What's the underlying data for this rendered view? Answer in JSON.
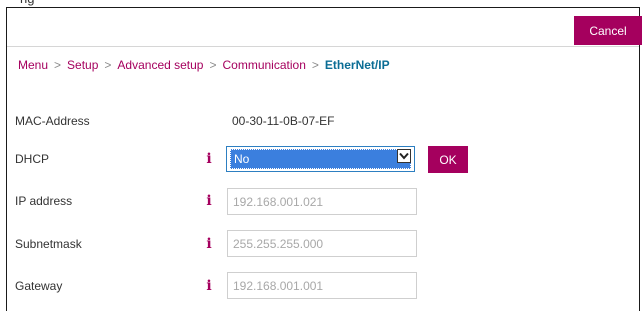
{
  "top_strip": {
    "text": "ng"
  },
  "header": {
    "cancel_label": "Cancel"
  },
  "breadcrumb": {
    "items": [
      "Menu",
      "Setup",
      "Advanced setup",
      "Communication"
    ],
    "separator": ">",
    "current": "EtherNet/IP"
  },
  "fields": {
    "mac": {
      "label": "MAC-Address",
      "value": "00-30-11-0B-07-EF"
    },
    "dhcp": {
      "label": "DHCP",
      "selected": "No",
      "ok_label": "OK"
    },
    "ip": {
      "label": "IP address",
      "value": "192.168.001.021"
    },
    "subnet": {
      "label": "Subnetmask",
      "value": "255.255.255.000"
    },
    "gateway": {
      "label": "Gateway",
      "value": "192.168.001.001"
    }
  },
  "info_glyph": "i",
  "colors": {
    "accent": "#a5005e",
    "breadcrumb_current": "#0b6d95",
    "select_highlight": "#3b7fde"
  }
}
